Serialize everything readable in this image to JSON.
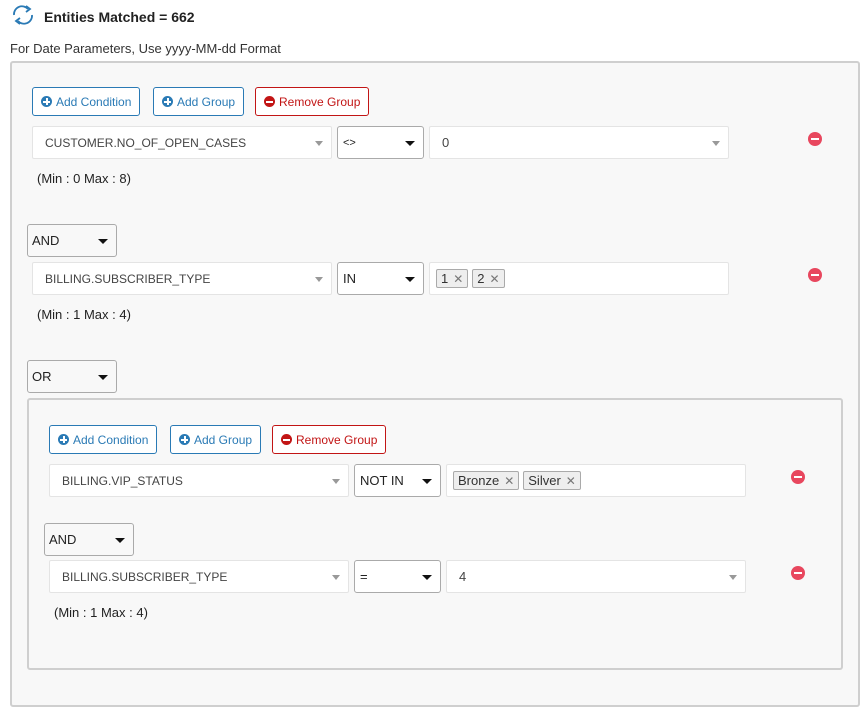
{
  "header": {
    "refresh_icon": "refresh-icon",
    "title": "Entities Matched = 662"
  },
  "date_hint": "For Date Parameters, Use yyyy-MM-dd Format",
  "root_group": {
    "buttons": {
      "add_condition": "Add Condition",
      "add_group": "Add Group",
      "remove_group": "Remove Group"
    },
    "conditions": [
      {
        "field": "CUSTOMER.NO_OF_OPEN_CASES",
        "operator": "<>",
        "value": "0",
        "range": "(Min : 0 Max : 8)"
      },
      {
        "logic": "AND",
        "field": "BILLING.SUBSCRIBER_TYPE",
        "operator": "IN",
        "tags": [
          "1",
          "2"
        ],
        "range": "(Min : 1 Max : 4)"
      }
    ],
    "group_logic": "OR"
  },
  "nested_group": {
    "buttons": {
      "add_condition": "Add Condition",
      "add_group": "Add Group",
      "remove_group": "Remove Group"
    },
    "conditions": [
      {
        "field": "BILLING.VIP_STATUS",
        "operator": "NOT IN",
        "tags": [
          "Bronze",
          "Silver"
        ]
      },
      {
        "logic": "AND",
        "field": "BILLING.SUBSCRIBER_TYPE",
        "operator": "=",
        "value": "4",
        "range": "(Min : 1 Max : 4)"
      }
    ]
  },
  "colors": {
    "primary_blue": "#2a7ab5",
    "danger_red": "#c21515",
    "remove_condition_pink": "#e8475e"
  }
}
